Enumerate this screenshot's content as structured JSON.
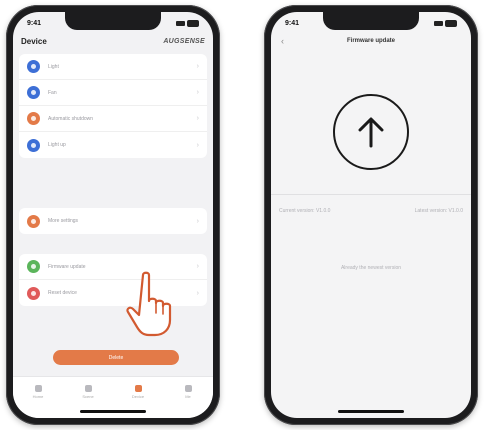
{
  "colors": {
    "accent": "#e37a48"
  },
  "left_phone": {
    "status_time": "9:41",
    "header": {
      "title": "Device",
      "brand": "AUGSENSE"
    },
    "groups": [
      [
        {
          "label": "Light",
          "icon": "light-icon",
          "color": "#3d6fd6"
        },
        {
          "label": "Fan",
          "icon": "fan-icon",
          "color": "#3d6fd6"
        },
        {
          "label": "Automatic shutdown",
          "icon": "timer-icon",
          "color": "#e37a48"
        },
        {
          "label": "Light up",
          "icon": "power-icon",
          "color": "#3d6fd6"
        }
      ],
      [
        {
          "label": "More settings",
          "icon": "settings-icon",
          "color": "#e37a48"
        }
      ],
      [
        {
          "label": "Firmware update",
          "icon": "firmware-icon",
          "color": "#5bb55b"
        },
        {
          "label": "Reset device",
          "icon": "reset-icon",
          "color": "#e05a5a"
        }
      ]
    ],
    "primary_button": "Delete",
    "tabs": [
      {
        "label": "Home",
        "icon": "home-icon",
        "active": false
      },
      {
        "label": "Scene",
        "icon": "scene-icon",
        "active": false
      },
      {
        "label": "Device",
        "icon": "device-icon",
        "active": true
      },
      {
        "label": "Me",
        "icon": "profile-icon",
        "active": false
      }
    ]
  },
  "right_phone": {
    "status_time": "9:41",
    "title": "Firmware update",
    "current_version_text": "Current version: V1.0.0",
    "latest_version_text": "Latest version: V1.0.0",
    "hint_text": "Already the newest version"
  }
}
